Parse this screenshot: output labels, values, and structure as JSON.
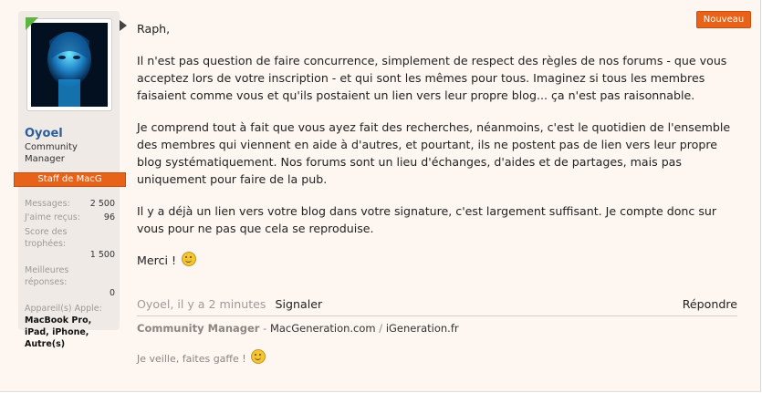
{
  "user": {
    "name": "Oyoel",
    "title": "Community Manager",
    "badge": "Staff de MacG",
    "stats": [
      {
        "label": "Messages:",
        "value": "2 500"
      },
      {
        "label": "J'aime reçus:",
        "value": "96"
      },
      {
        "label": "Score des trophées:",
        "value": "1 500"
      },
      {
        "label": "Meilleures réponses:",
        "value": "0"
      }
    ],
    "devices_label": "Appareil(s) Apple:",
    "devices_value": "MacBook Pro, iPad, iPhone, Autre(s)"
  },
  "badge_new": "Nouveau",
  "message": {
    "greeting": "Raph,",
    "paragraphs": [
      "Il n'est pas question de faire concurrence, simplement de respect des règles de nos forums - que vous acceptez lors de votre inscription - et qui sont les mêmes pour tous. Imaginez si tous les membres faisaient comme vous et qu'ils postaient un lien vers leur propre blog... ça n'est pas raisonnable.",
      "Je comprend tout à fait que vous ayez fait des recherches, néanmoins, c'est le quotidien de l'ensemble des membres qui viennent en aide à d'autres, et pourtant, ils ne postent pas de lien vers leur propre blog systématiquement. Nos forums sont un lieu d'échanges, d'aides et de partages, mais pas uniquement pour faire de la pub.",
      "Il y a déjà un lien vers votre blog dans votre signature, c'est largement suffisant. Je compte donc sur vous pour ne pas que cela se reproduise."
    ],
    "closing": "Merci !"
  },
  "meta": {
    "author_time": "Oyoel, il y a 2 minutes",
    "report": "Signaler",
    "reply": "Répondre"
  },
  "signature": {
    "role": "Community Manager",
    "dash": " - ",
    "site1": "MacGeneration.com",
    "slash": " / ",
    "site2": "iGeneration.fr",
    "line2": "Je veille, faites gaffe !"
  },
  "icons": {
    "smiley": "smiley-icon",
    "online": "online-indicator-icon",
    "pointer": "message-pointer-icon"
  },
  "colors": {
    "accent": "#e8631a",
    "username": "#2b5e9a",
    "background": "#fdf6f1"
  }
}
